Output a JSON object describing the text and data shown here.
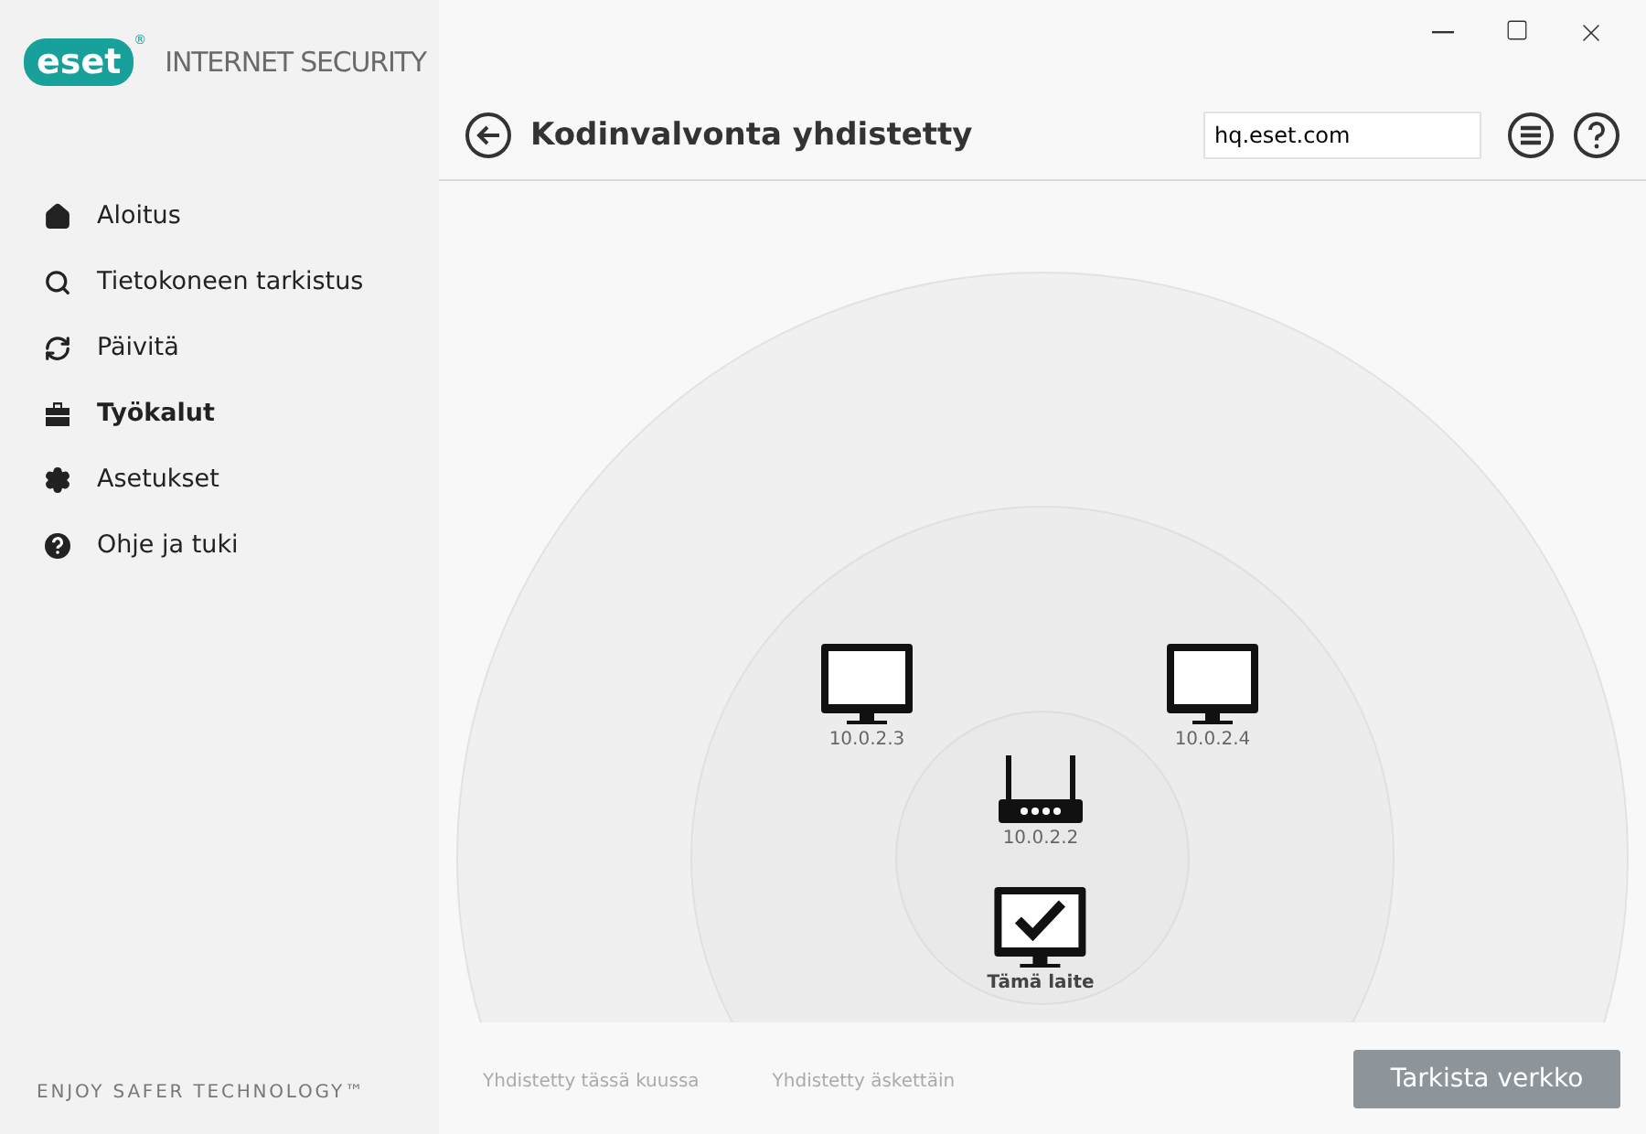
{
  "brand": {
    "logo": "eset",
    "registered": "®",
    "product": "INTERNET SECURITY"
  },
  "sidebar": {
    "items": [
      {
        "label": "Aloitus",
        "selected": false
      },
      {
        "label": "Tietokoneen tarkistus",
        "selected": false
      },
      {
        "label": "Päivitä",
        "selected": false
      },
      {
        "label": "Työkalut",
        "selected": true
      },
      {
        "label": "Asetukset",
        "selected": false
      },
      {
        "label": "Ohje ja tuki",
        "selected": false
      }
    ],
    "slogan": "ENJOY SAFER TECHNOLOGY™"
  },
  "header": {
    "title": "Kodinvalvonta yhdistetty",
    "search": {
      "value": "hq.eset.com"
    }
  },
  "network": {
    "nodes": [
      {
        "kind": "computer",
        "label": "10.0.2.3"
      },
      {
        "kind": "computer",
        "label": "10.0.2.4"
      },
      {
        "kind": "router",
        "label": "10.0.2.2"
      },
      {
        "kind": "this_device",
        "label": "Tämä laite"
      }
    ],
    "legend": [
      "Yhdistetty tässä kuussa",
      "Yhdistetty äskettäin"
    ]
  },
  "scan_button": "Tarkista verkko"
}
